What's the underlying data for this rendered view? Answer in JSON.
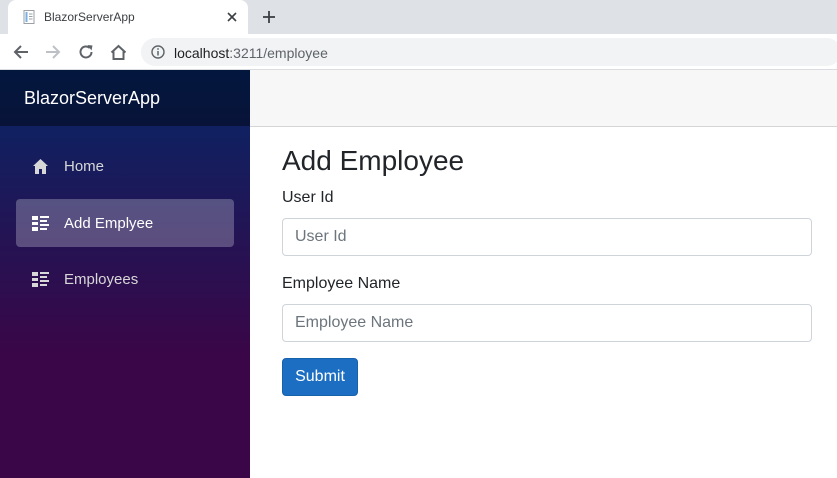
{
  "browser": {
    "tab_title": "BlazorServerApp",
    "url_host": "localhost",
    "url_path": ":3211/employee",
    "icons": {
      "favicon": "page-icon",
      "tab_close": "close-icon",
      "new_tab": "plus-icon",
      "back": "arrow-left-icon",
      "forward": "arrow-right-icon",
      "reload": "reload-icon",
      "home": "home-icon",
      "site_info": "info-icon"
    }
  },
  "sidebar": {
    "brand": "BlazorServerApp",
    "items": [
      {
        "label": "Home",
        "icon": "home-icon",
        "active": false
      },
      {
        "label": "Add Emplyee",
        "icon": "list-icon",
        "active": true
      },
      {
        "label": "Employees",
        "icon": "list-icon",
        "active": false
      }
    ]
  },
  "main": {
    "title": "Add Employee",
    "fields": [
      {
        "label": "User Id",
        "placeholder": "User Id",
        "value": ""
      },
      {
        "label": "Employee Name",
        "placeholder": "Employee Name",
        "value": ""
      }
    ],
    "submit_label": "Submit"
  },
  "colors": {
    "sidebar_top": "#052767",
    "sidebar_bottom": "#3a0647",
    "primary_button": "#1b6ec2"
  }
}
